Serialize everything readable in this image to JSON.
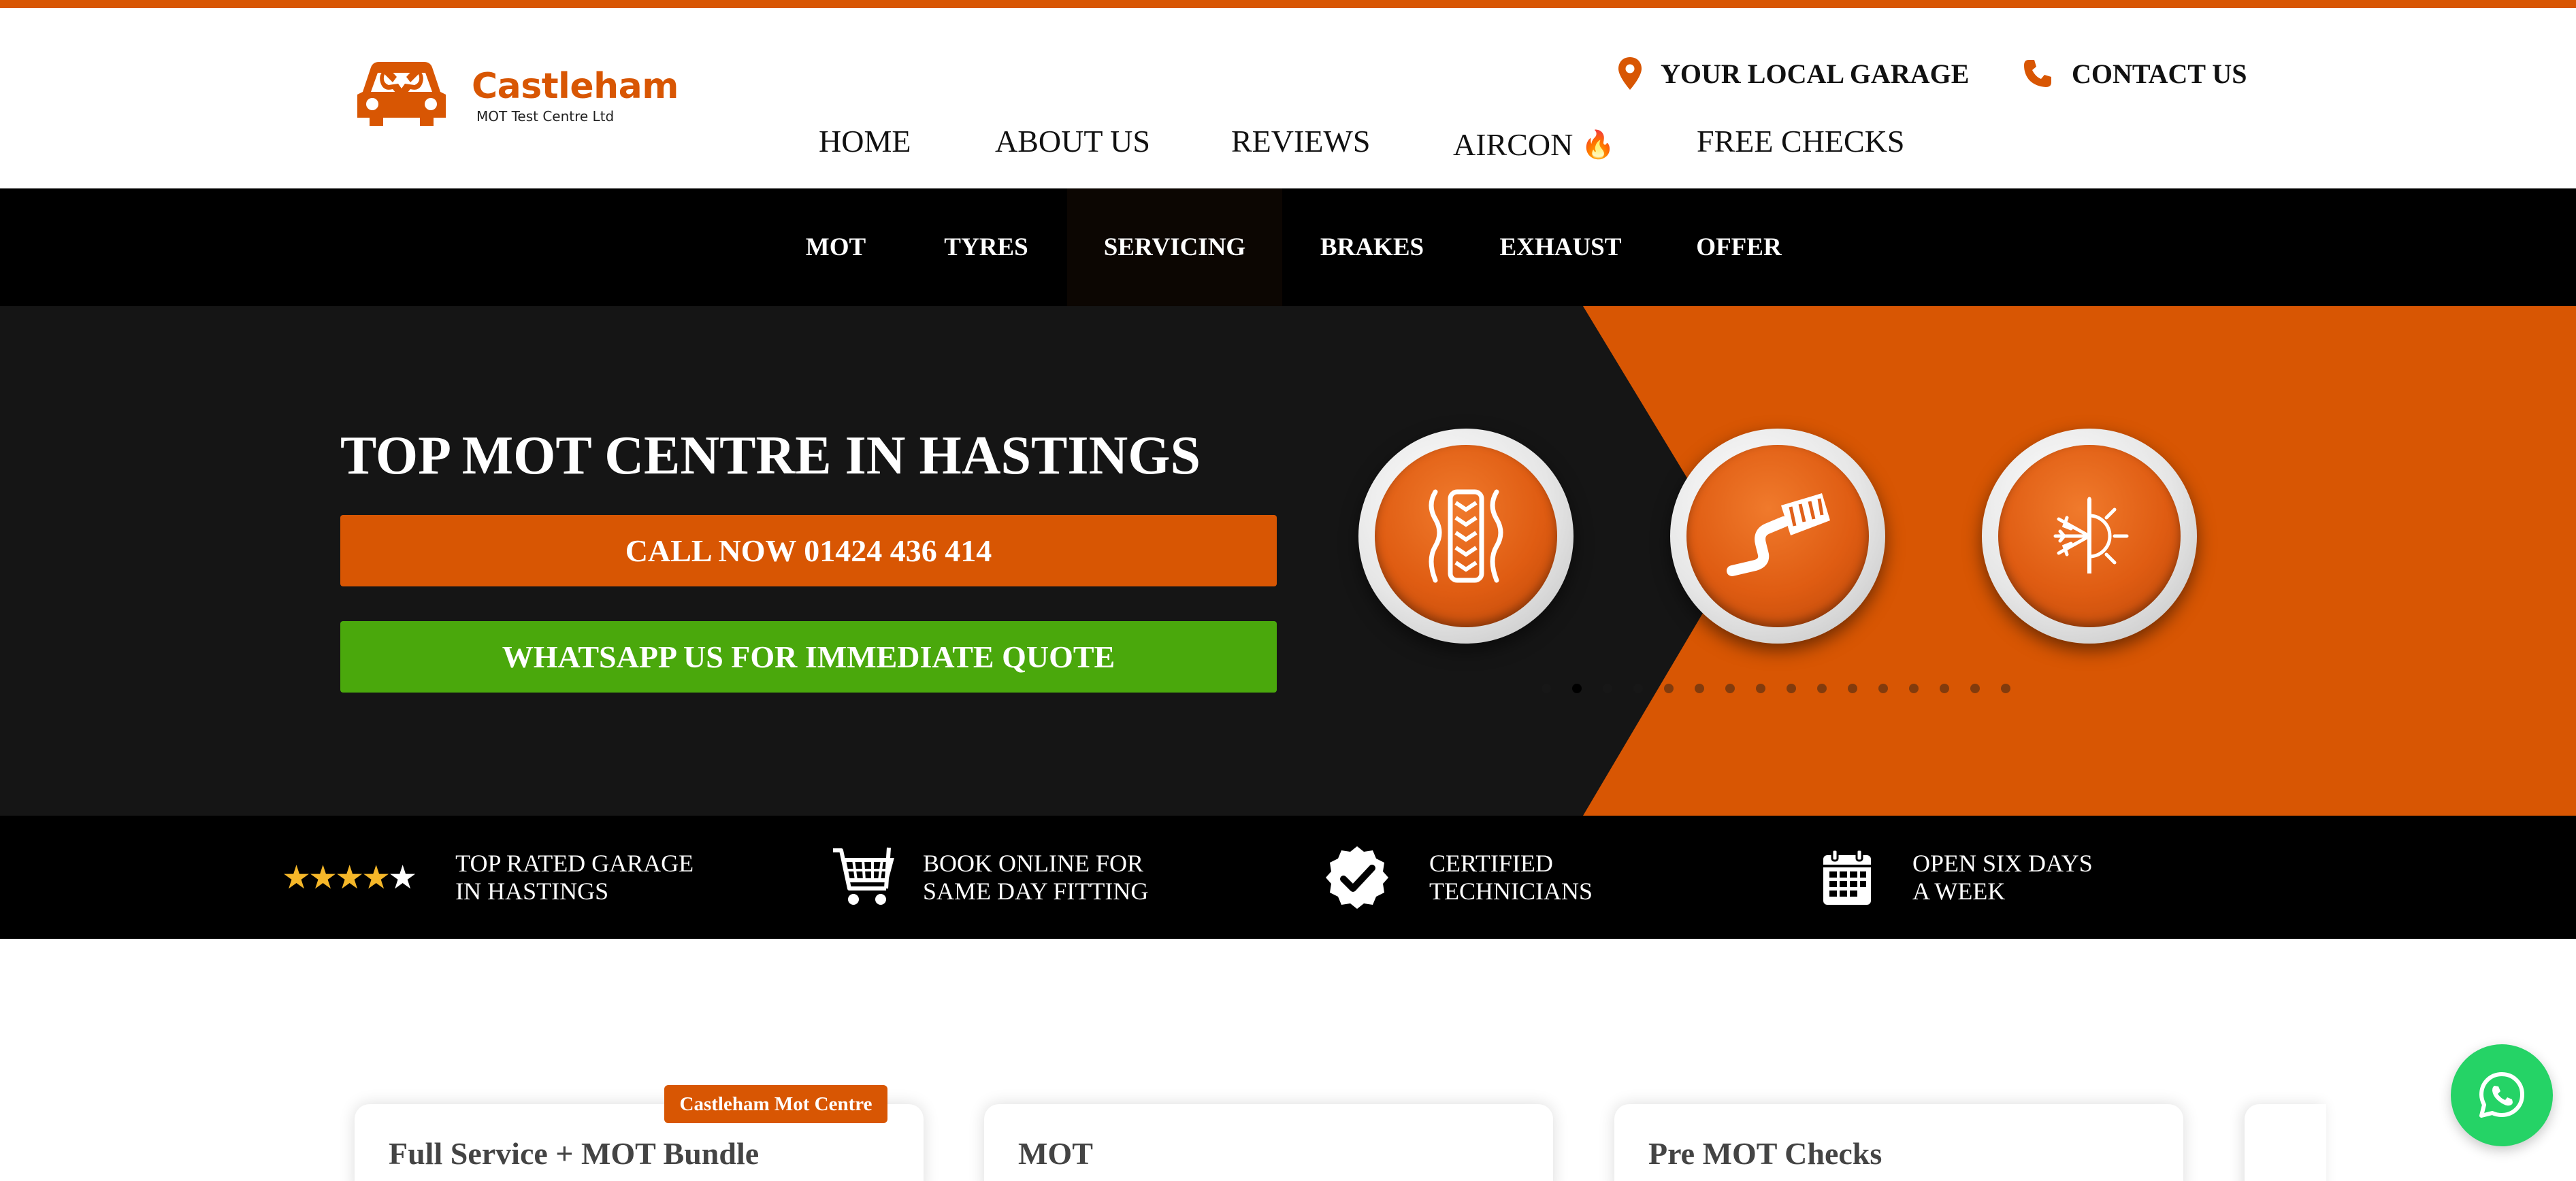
{
  "brand": {
    "name": "Castleham",
    "subtitle": "MOT Test Centre Ltd",
    "color": "#d85603"
  },
  "header": {
    "utility": {
      "garage_label": "YOUR LOCAL GARAGE",
      "garage_icon": "location-pin-icon",
      "contact_label": "CONTACT US",
      "contact_icon": "phone-icon"
    },
    "nav": [
      {
        "label": "HOME"
      },
      {
        "label": "ABOUT US"
      },
      {
        "label": "REVIEWS"
      },
      {
        "label": "AIRCON",
        "icon": "fire-icon"
      },
      {
        "label": "FREE CHECKS"
      }
    ]
  },
  "service_nav": {
    "items": [
      {
        "label": "MOT"
      },
      {
        "label": "TYRES"
      },
      {
        "label": "SERVICING",
        "active": true
      },
      {
        "label": "BRAKES"
      },
      {
        "label": "EXHAUST"
      },
      {
        "label": "OFFER"
      }
    ]
  },
  "hero": {
    "title": "TOP MOT CENTRE IN HASTINGS",
    "call_button": "CALL NOW 01424 436 414",
    "whatsapp_button": "WHATSAPP US FOR IMMEDIATE QUOTE",
    "carousel_icons": [
      "tyre-tread-icon",
      "exhaust-pipe-icon",
      "aircon-snowflake-sun-icon"
    ],
    "carousel_dot_count": 16,
    "carousel_active_index": 1,
    "colors": {
      "dark": "#151515",
      "orange": "#d85603",
      "green": "#4aa80c"
    }
  },
  "features": [
    {
      "icon": "stars-rating-icon",
      "rating": 4,
      "line1": "TOP RATED GARAGE",
      "line2": "IN HASTINGS"
    },
    {
      "icon": "shopping-cart-icon",
      "line1": "BOOK ONLINE FOR",
      "line2": "SAME DAY FITTING"
    },
    {
      "icon": "verified-badge-icon",
      "line1": "CERTIFIED",
      "line2": "TECHNICIANS"
    },
    {
      "icon": "calendar-icon",
      "line1": "OPEN SIX DAYS",
      "line2": "A WEEK"
    }
  ],
  "cards": [
    {
      "title": "Full Service + MOT Bundle",
      "badge": "Castleham Mot Centre"
    },
    {
      "title": "MOT"
    },
    {
      "title": "Pre MOT Checks"
    }
  ],
  "floating": {
    "icon": "whatsapp-icon",
    "color": "#25d366"
  }
}
